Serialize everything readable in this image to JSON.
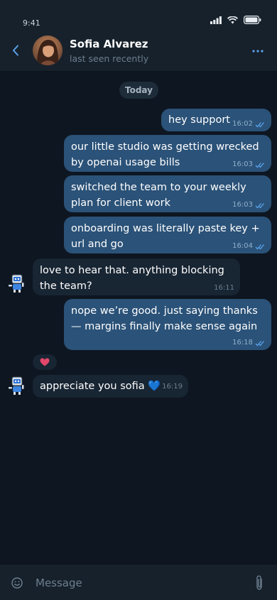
{
  "status_bar": {
    "time": "9:41"
  },
  "header": {
    "name": "Sofia Alvarez",
    "status": "last seen recently",
    "back_icon": "chevron-left-icon",
    "menu_icon": "ellipsis-icon"
  },
  "date_separator": "Today",
  "messages": [
    {
      "direction": "out",
      "text": "hey support",
      "time": "16:02",
      "read": true
    },
    {
      "direction": "out",
      "text": "our little studio was getting wrecked by openai usage bills",
      "time": "16:03",
      "read": true
    },
    {
      "direction": "out",
      "text": "switched the team to your weekly plan for client work",
      "time": "16:03",
      "read": true
    },
    {
      "direction": "out",
      "text": "onboarding was literally paste key + url and go",
      "time": "16:04",
      "read": true
    },
    {
      "direction": "in",
      "text": "love to hear that. anything blocking the team?",
      "time": "16:11"
    },
    {
      "direction": "out",
      "text": "nope we’re good. just saying thanks — margins finally make sense again",
      "time": "16:18",
      "read": true
    },
    {
      "direction": "in",
      "text": "appreciate you sofia 💙",
      "time": "16:19"
    }
  ],
  "reaction": {
    "emoji": "heart-icon",
    "color": "#e2476a"
  },
  "composer": {
    "placeholder": "Message",
    "emoji_icon": "smiley-icon",
    "attach_icon": "paperclip-icon"
  },
  "colors": {
    "background": "#0e1621",
    "header": "#17212b",
    "outgoing_bubble": "#2b5278",
    "incoming_bubble": "#182533",
    "accent": "#5aa4ee"
  }
}
